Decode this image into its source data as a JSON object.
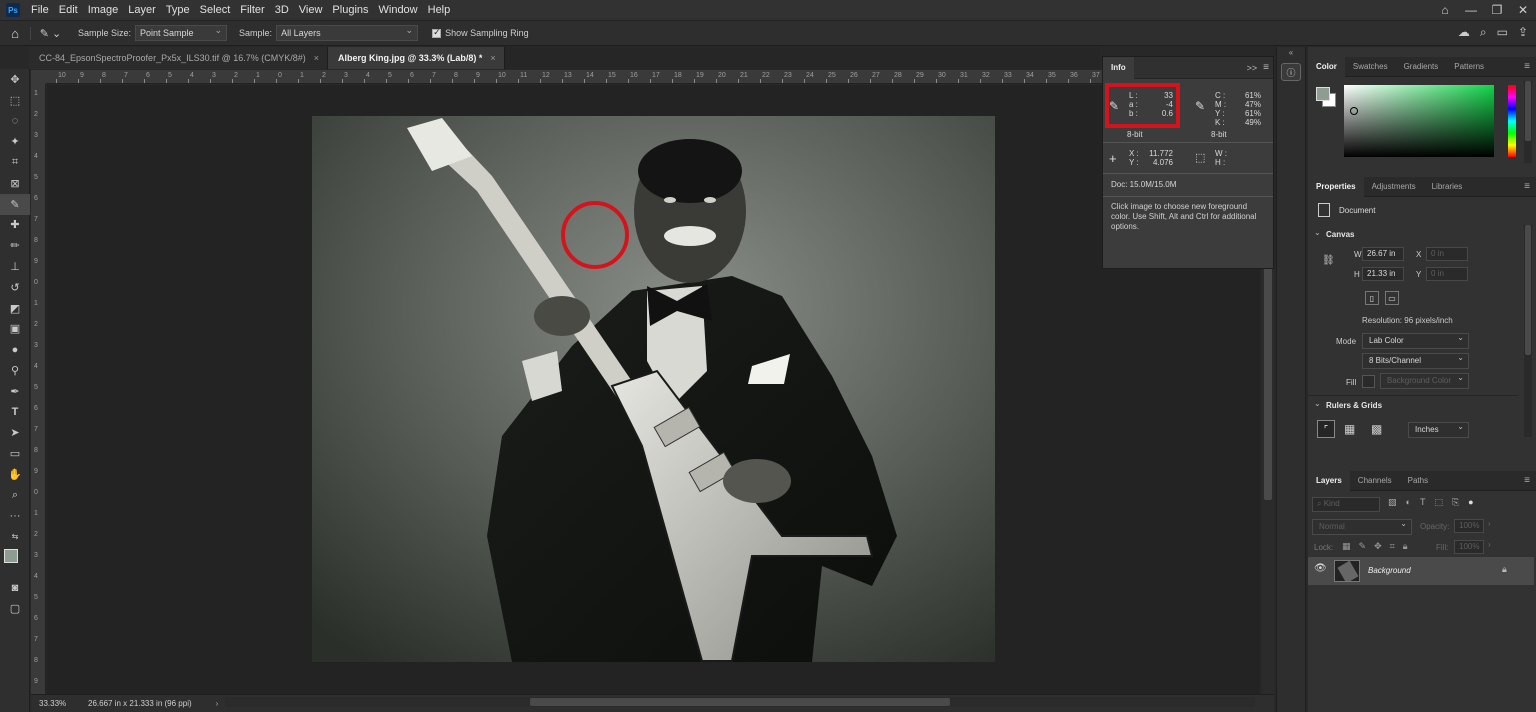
{
  "menubar": {
    "logo": "Ps",
    "items": [
      "File",
      "Edit",
      "Image",
      "Layer",
      "Type",
      "Select",
      "Filter",
      "3D",
      "View",
      "Plugins",
      "Window",
      "Help"
    ]
  },
  "options": {
    "sample_size_label": "Sample Size:",
    "sample_size_value": "Point Sample",
    "sample_label": "Sample:",
    "sample_value": "All Layers",
    "show_ring_label": "Show Sampling Ring"
  },
  "tabs": [
    {
      "label": "CC-84_EpsonSpectroProofer_Px5x_ILS30.tif @ 16.7% (CMYK/8#)",
      "close": "×"
    },
    {
      "label": "Alberg King.jpg @ 33.3% (Lab/8) *",
      "close": "×"
    }
  ],
  "ruler_top": [
    "10",
    "9",
    "8",
    "7",
    "6",
    "5",
    "4",
    "3",
    "2",
    "1",
    "0",
    "1",
    "2",
    "3",
    "4",
    "5",
    "6",
    "7",
    "8",
    "9",
    "10",
    "11",
    "12",
    "13",
    "14",
    "15",
    "16",
    "17",
    "18",
    "19",
    "20",
    "21",
    "22",
    "23",
    "24",
    "25",
    "26",
    "27",
    "28",
    "29",
    "30",
    "31",
    "32",
    "33",
    "34",
    "35",
    "36",
    "37"
  ],
  "ruler_left": [
    "1",
    "2",
    "3",
    "4",
    "5",
    "6",
    "7",
    "8",
    "9",
    "0",
    "1",
    "2",
    "3",
    "4",
    "5",
    "6",
    "7",
    "8",
    "9",
    "0",
    "1",
    "2",
    "3",
    "4",
    "5",
    "6",
    "7",
    "8",
    "9"
  ],
  "status": {
    "zoom": "33.33%",
    "doc_size": "26.667 in x 21.333 in (96 ppi)"
  },
  "info": {
    "tab": "Info",
    "expand": ">>",
    "lab": {
      "L_label": "L :",
      "L": "33",
      "a_label": "a :",
      "a": "-4",
      "b_label": "b :",
      "b": "0.6"
    },
    "cmyk": {
      "C_label": "C :",
      "C": "61%",
      "M_label": "M :",
      "M": "47%",
      "Y_label": "Y :",
      "Y": "61%",
      "K_label": "K :",
      "K": "49%"
    },
    "bit_left": "8-bit",
    "bit_right": "8-bit",
    "x_label": "X :",
    "x": "11.772",
    "y_label": "Y :",
    "y": "4.076",
    "w_label": "W :",
    "h_label": "H :",
    "doc": "Doc: 15.0M/15.0M",
    "description": "Click image to choose new foreground color.  Use Shift, Alt and Ctrl for additional options."
  },
  "color_panel": {
    "tabs": [
      "Color",
      "Swatches",
      "Gradients",
      "Patterns"
    ]
  },
  "properties": {
    "tabs": [
      "Properties",
      "Adjustments",
      "Libraries"
    ],
    "document_label": "Document",
    "canvas_title": "Canvas",
    "w_label": "W",
    "w_value": "26.67 in",
    "h_label": "H",
    "h_value": "21.33 in",
    "x_label": "X",
    "x_value": "0 in",
    "y_label": "Y",
    "y_value": "0 in",
    "resolution": "Resolution: 96 pixels/inch",
    "mode_label": "Mode",
    "mode_value": "Lab Color",
    "bits_value": "8 Bits/Channel",
    "fill_label": "Fill",
    "fill_value": "Background Color",
    "rulers_title": "Rulers & Grids",
    "units_value": "Inches"
  },
  "layers": {
    "tabs": [
      "Layers",
      "Channels",
      "Paths"
    ],
    "kind_placeholder": "Kind",
    "blend_mode": "Normal",
    "opacity_label": "Opacity:",
    "opacity_value": "100%",
    "lock_label": "Lock:",
    "fill_label": "Fill:",
    "fill_value": "100%",
    "layer_name": "Background"
  },
  "colors": {
    "accent_red": "#d4141c",
    "fg_swatch": "#8f9c92",
    "bg_swatch": "#ffffff"
  }
}
